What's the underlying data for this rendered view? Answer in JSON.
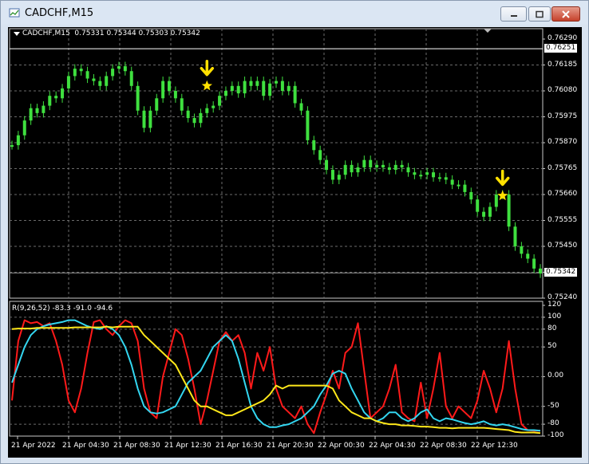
{
  "window": {
    "title": "CADCHF,M15",
    "buttons": {
      "minimize": "minimize-icon",
      "maximize": "maximize-icon",
      "close": "close-icon"
    }
  },
  "colors": {
    "background": "#000000",
    "grid": "#6b6b6b",
    "candle": "#3fe03f",
    "line_red": "#ff1a1a",
    "line_cyan": "#33d6f0",
    "line_yellow": "#ffe81a",
    "signal": "#ffe000"
  },
  "price_panel": {
    "ohlc_label": "CADCHF,M15  0.75331 0.75344 0.75303 0.75342",
    "y_ticks": [
      "0.76290",
      "0.76185",
      "0.76080",
      "0.75975",
      "0.75870",
      "0.75765",
      "0.75660",
      "0.75555",
      "0.75450",
      "0.75345",
      "0.75240"
    ],
    "highlight_level": "0.76251",
    "current_price": "0.75342"
  },
  "indicator_panel": {
    "label": "R(9,26,52) -83.3 -91.0 -94.6",
    "y_ticks": [
      "120",
      "100",
      "80",
      "50",
      "0.00",
      "-50",
      "-80",
      "-100"
    ]
  },
  "x_ticks": [
    "21 Apr 2022",
    "21 Apr 04:30",
    "21 Apr 08:30",
    "21 Apr 12:30",
    "21 Apr 16:30",
    "21 Apr 20:30",
    "22 Apr 00:30",
    "22 Apr 04:30",
    "22 Apr 08:30",
    "22 Apr 12:30"
  ],
  "chart_data": {
    "type": "line",
    "series": [
      {
        "values": [
          0.7586,
          0.759,
          0.7596,
          0.7601,
          0.7599,
          0.7602,
          0.7606,
          0.7605,
          0.7609,
          0.7614,
          0.7617,
          0.7616,
          0.7613,
          0.7612,
          0.761,
          0.7614,
          0.7617,
          0.7618,
          0.7616,
          0.761,
          0.76,
          0.7593,
          0.76,
          0.7605,
          0.7612,
          0.7608,
          0.7605,
          0.76,
          0.7597,
          0.7595,
          0.7599,
          0.7601,
          0.7602,
          0.7606,
          0.7608,
          0.761,
          0.7607,
          0.7612,
          0.761,
          0.7612,
          0.7606,
          0.7611,
          0.7612,
          0.7608,
          0.761,
          0.7603,
          0.76,
          0.7588,
          0.7584,
          0.758,
          0.7576,
          0.7572,
          0.7574,
          0.7578,
          0.7575,
          0.7577,
          0.758,
          0.7577,
          0.7578,
          0.7577,
          0.7576,
          0.7578,
          0.7577,
          0.7575,
          0.7574,
          0.7574,
          0.7575,
          0.7573,
          0.7573,
          0.7572,
          0.757,
          0.757,
          0.7567,
          0.7564,
          0.7559,
          0.7557,
          0.7561,
          0.7566,
          0.7566,
          0.7553,
          0.7545,
          0.7542,
          0.754,
          0.7536,
          0.7534
        ]
      },
      {
        "values": [
          -40,
          60,
          95,
          90,
          92,
          85,
          90,
          60,
          20,
          -40,
          -60,
          -20,
          40,
          92,
          95,
          80,
          70,
          85,
          95,
          90,
          60,
          -20,
          -60,
          -70,
          0,
          40,
          80,
          70,
          30,
          -20,
          -80,
          -40,
          10,
          60,
          75,
          60,
          70,
          40,
          -20,
          40,
          10,
          50,
          -20,
          -50,
          -60,
          -70,
          -50,
          -80,
          -95,
          -60,
          -30,
          10,
          -20,
          40,
          50,
          90,
          10,
          -70,
          -60,
          -50,
          -20,
          20,
          -60,
          -70,
          -75,
          -10,
          -70,
          -20,
          40,
          -50,
          -70,
          -50,
          -60,
          -70,
          -40,
          10,
          -20,
          -60,
          -20,
          60,
          -20,
          -80,
          -90,
          -91,
          -91
        ]
      },
      {
        "values": [
          -10,
          20,
          50,
          70,
          80,
          85,
          88,
          90,
          92,
          95,
          95,
          90,
          85,
          82,
          80,
          85,
          80,
          70,
          50,
          20,
          -20,
          -50,
          -60,
          -62,
          -60,
          -55,
          -50,
          -30,
          -10,
          0,
          10,
          30,
          50,
          60,
          70,
          60,
          30,
          -10,
          -50,
          -70,
          -80,
          -85,
          -85,
          -82,
          -80,
          -75,
          -70,
          -60,
          -50,
          -30,
          -15,
          5,
          10,
          5,
          -20,
          -40,
          -60,
          -70,
          -75,
          -70,
          -60,
          -60,
          -70,
          -75,
          -70,
          -60,
          -55,
          -70,
          -75,
          -70,
          -72,
          -75,
          -78,
          -80,
          -78,
          -75,
          -80,
          -82,
          -80,
          -82,
          -85,
          -88,
          -90,
          -90,
          -91
        ]
      },
      {
        "values": [
          80,
          81,
          81,
          81,
          82,
          82,
          82,
          82,
          82,
          82,
          83,
          83,
          83,
          83,
          83,
          84,
          83,
          84,
          84,
          84,
          84,
          70,
          60,
          50,
          40,
          30,
          20,
          0,
          -20,
          -40,
          -50,
          -50,
          -55,
          -60,
          -65,
          -65,
          -60,
          -55,
          -50,
          -45,
          -40,
          -30,
          -15,
          -20,
          -15,
          -15,
          -15,
          -15,
          -15,
          -15,
          -15,
          -20,
          -40,
          -50,
          -60,
          -65,
          -70,
          -70,
          -75,
          -78,
          -80,
          -80,
          -82,
          -82,
          -83,
          -84,
          -84,
          -85,
          -86,
          -86,
          -87,
          -86,
          -86,
          -86,
          -86,
          -86,
          -87,
          -88,
          -89,
          -90,
          -93,
          -94,
          -94,
          -94,
          -95
        ]
      }
    ],
    "ylim_price": [
      0.7524,
      0.7629
    ],
    "ylim_indicator": [
      -100,
      120
    ],
    "signals": [
      {
        "bar": 31,
        "price": 0.7611
      },
      {
        "bar": 78,
        "price": 0.75665
      }
    ]
  }
}
